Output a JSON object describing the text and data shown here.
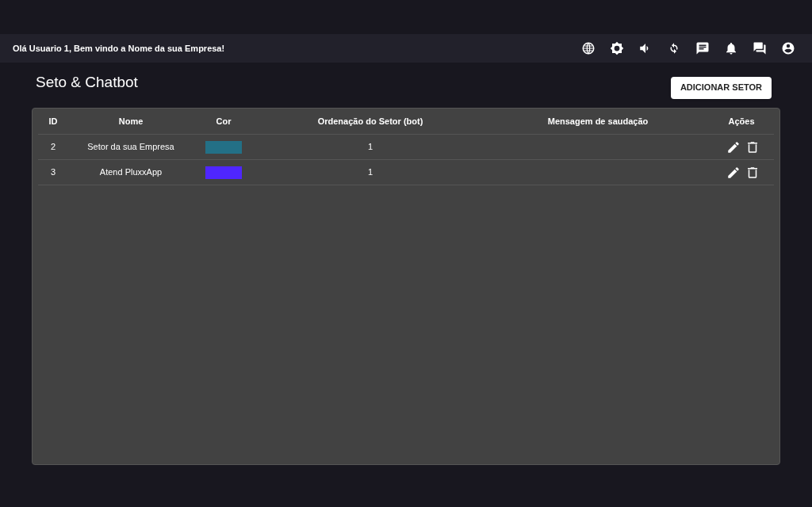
{
  "app_bar": {
    "greeting": "Olá Usuario 1, Bem vindo a Nome da sua Empresa!"
  },
  "page": {
    "title": "Seto & Chatbot",
    "add_button": "ADICIONAR SETOR"
  },
  "table": {
    "columns": [
      "ID",
      "Nome",
      "Cor",
      "Ordenação do Setor (bot)",
      "Mensagem de saudação",
      "Ações"
    ],
    "rows": [
      {
        "id": "2",
        "name": "Setor da sua Empresa",
        "color": "#237086",
        "order": "1"
      },
      {
        "id": "3",
        "name": "Atend PluxxApp",
        "color": "#4f26ff",
        "order": "1"
      }
    ]
  }
}
